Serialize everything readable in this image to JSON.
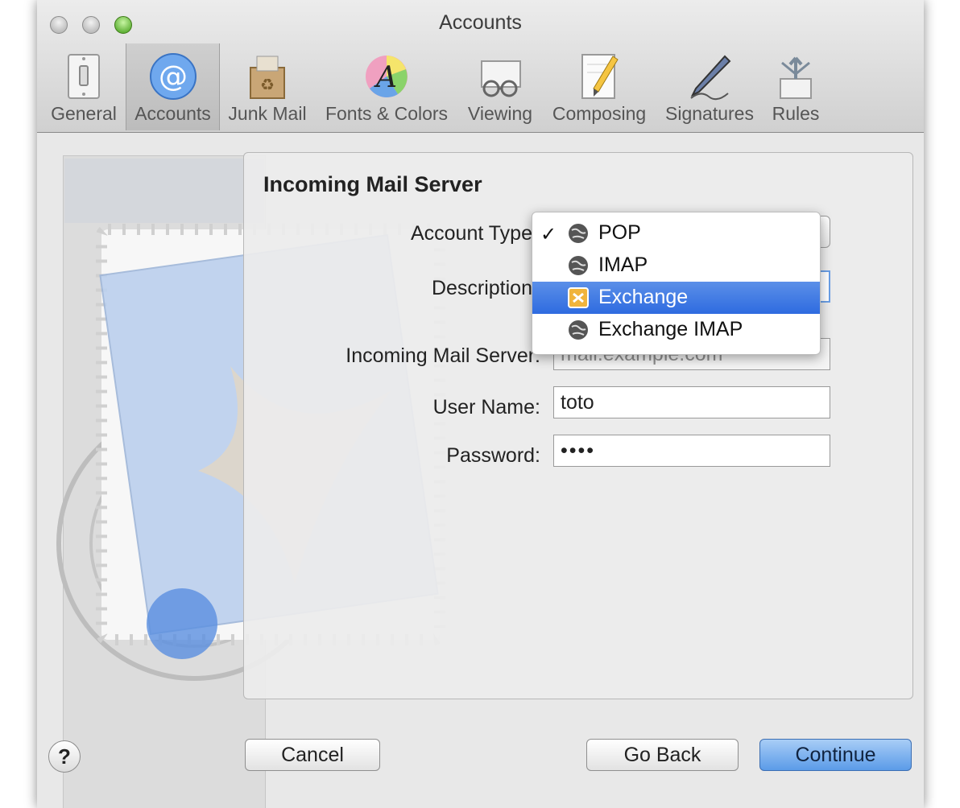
{
  "window": {
    "title": "Accounts"
  },
  "toolbar": {
    "items": [
      {
        "label": "General",
        "icon": "switch-icon"
      },
      {
        "label": "Accounts",
        "icon": "at-icon"
      },
      {
        "label": "Junk Mail",
        "icon": "recycle-package-icon"
      },
      {
        "label": "Fonts & Colors",
        "icon": "font-color-wheel-icon"
      },
      {
        "label": "Viewing",
        "icon": "glasses-envelope-icon"
      },
      {
        "label": "Composing",
        "icon": "pencil-paper-icon"
      },
      {
        "label": "Signatures",
        "icon": "pen-icon"
      },
      {
        "label": "Rules",
        "icon": "rules-arrows-icon"
      }
    ],
    "selected": "Accounts"
  },
  "dialog": {
    "heading": "Incoming Mail Server",
    "account_type_label": "Account Type",
    "description_label": "Description",
    "incoming_server_label": "Incoming Mail Server:",
    "incoming_server_placeholder": "mail.example.com",
    "username_label": "User Name:",
    "username_value": "toto",
    "password_label": "Password:",
    "password_value": "••••"
  },
  "account_type_menu": {
    "checkmark": "✓",
    "options": [
      "POP",
      "IMAP",
      "Exchange",
      "Exchange IMAP"
    ],
    "checked": "POP",
    "highlighted": "Exchange"
  },
  "buttons": {
    "help": "?",
    "cancel": "Cancel",
    "go_back": "Go Back",
    "continue": "Continue"
  },
  "colors": {
    "highlight": "#3a74e2",
    "default_button": "#6aa6ec"
  }
}
